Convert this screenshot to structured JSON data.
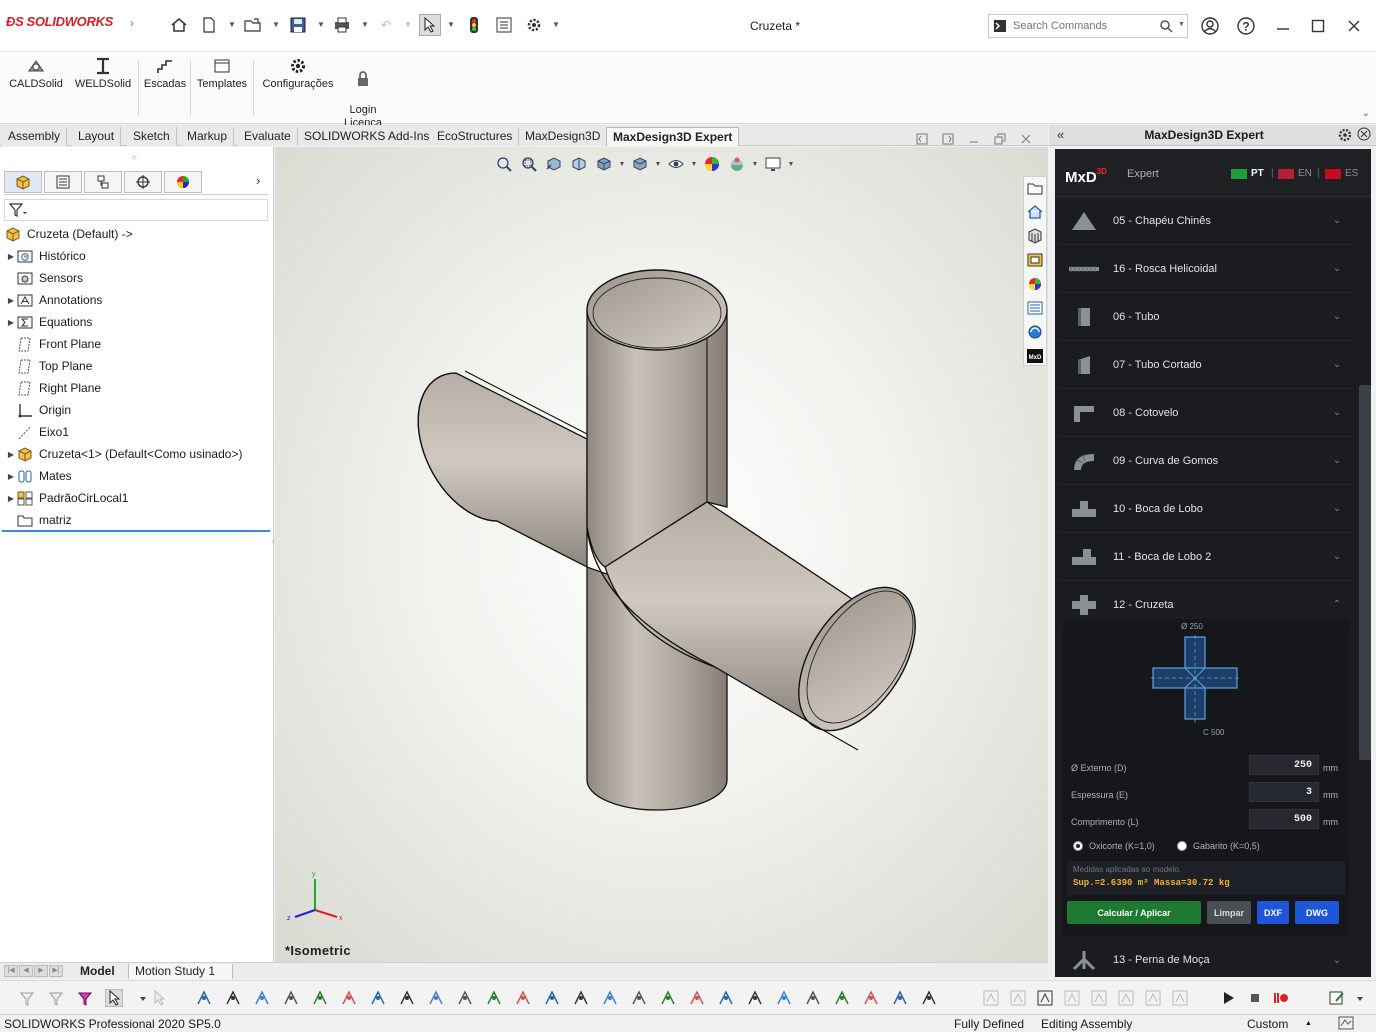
{
  "app": {
    "logo": "SOLIDWORKS",
    "document_title": "Cruzeta *",
    "search_placeholder": "Search Commands"
  },
  "ribbon": {
    "buttons": [
      {
        "label": "CALDSolid",
        "icon": "caldsolid-icon"
      },
      {
        "label": "WELDSolid",
        "icon": "weldsolid-icon"
      },
      {
        "label": "Escadas",
        "icon": "stairs-icon"
      },
      {
        "label": "Templates",
        "icon": "templates-icon"
      },
      {
        "label": "Configurações",
        "icon": "gear-icon"
      },
      {
        "label": "Login\nLicença",
        "icon": "lock-icon"
      }
    ]
  },
  "tabs": [
    {
      "label": "Assembly",
      "active": false
    },
    {
      "label": "Layout",
      "active": false
    },
    {
      "label": "Sketch",
      "active": false
    },
    {
      "label": "Markup",
      "active": false
    },
    {
      "label": "Evaluate",
      "active": false
    },
    {
      "label": "SOLIDWORKS Add-Ins",
      "active": false
    },
    {
      "label": "EcoStructures",
      "active": false
    },
    {
      "label": "MaxDesign3D",
      "active": false
    },
    {
      "label": "MaxDesign3D Expert",
      "active": true
    }
  ],
  "tree": {
    "root": "Cruzeta  (Default) ->",
    "items": [
      {
        "label": "Histórico",
        "icon": "history-folder-icon",
        "expandable": true
      },
      {
        "label": "Sensors",
        "icon": "sensors-folder-icon",
        "expandable": false
      },
      {
        "label": "Annotations",
        "icon": "annotations-icon",
        "expandable": true
      },
      {
        "label": "Equations",
        "icon": "equations-icon",
        "expandable": true
      },
      {
        "label": "Front Plane",
        "icon": "plane-icon",
        "expandable": false
      },
      {
        "label": "Top Plane",
        "icon": "plane-icon",
        "expandable": false
      },
      {
        "label": "Right Plane",
        "icon": "plane-icon",
        "expandable": false
      },
      {
        "label": "Origin",
        "icon": "origin-icon",
        "expandable": false
      },
      {
        "label": "Eixo1",
        "icon": "axis-icon",
        "expandable": false
      },
      {
        "label": "Cruzeta<1> (Default<Como usinado>)",
        "icon": "part-icon",
        "expandable": true
      },
      {
        "label": "Mates",
        "icon": "mates-icon",
        "expandable": true
      },
      {
        "label": "PadrãoCirLocal1",
        "icon": "circular-pattern-icon",
        "expandable": true
      },
      {
        "label": "matriz",
        "icon": "folder-icon",
        "expandable": false
      }
    ]
  },
  "viewport": {
    "view_label": "*Isometric",
    "triad": {
      "x": "x",
      "y": "y",
      "z": "z"
    }
  },
  "task_pane": {
    "title": "MaxDesign3D Expert",
    "panel": {
      "logo": "MxD",
      "logo_sup": "3D",
      "subtitle": "Expert",
      "languages": [
        {
          "code": "PT",
          "active": true,
          "flag_color": "#1f9d3a"
        },
        {
          "code": "EN",
          "active": false,
          "flag_color": "#b22234"
        },
        {
          "code": "ES",
          "active": false,
          "flag_color": "#c60b1e"
        }
      ],
      "categories": [
        {
          "label": "05 - Chapéu Chinês",
          "icon": "cone-icon",
          "expanded": false
        },
        {
          "label": "16 - Rosca Helicoidal",
          "icon": "helical-thread-icon",
          "expanded": false
        },
        {
          "label": "06 - Tubo",
          "icon": "tube-icon",
          "expanded": false
        },
        {
          "label": "07 - Tubo Cortado",
          "icon": "cut-tube-icon",
          "expanded": false
        },
        {
          "label": "08 - Cotovelo",
          "icon": "elbow-icon",
          "expanded": false
        },
        {
          "label": "09 - Curva de Gomos",
          "icon": "segmented-bend-icon",
          "expanded": false
        },
        {
          "label": "10 - Boca de Lobo",
          "icon": "saddle-icon",
          "expanded": false
        },
        {
          "label": "11 - Boca de Lobo 2",
          "icon": "saddle-2-icon",
          "expanded": false
        },
        {
          "label": "12 - Cruzeta",
          "icon": "cross-icon",
          "expanded": true
        }
      ],
      "detail": {
        "dim_diameter": "Ø 250",
        "dim_length": "C 500",
        "fields": [
          {
            "label": "Ø Externo (D)",
            "value": "250",
            "unit": "mm"
          },
          {
            "label": "Espessura (E)",
            "value": "3",
            "unit": "mm"
          },
          {
            "label": "Comprimento (L)",
            "value": "500",
            "unit": "mm"
          }
        ],
        "radios": [
          {
            "label": "Oxicorte (K=1,0)",
            "checked": true
          },
          {
            "label": "Gabarito (K=0,5)",
            "checked": false
          }
        ],
        "result_note": "Medidas aplicadas ao modelo.",
        "result_values": "Sup.=2.6390 m²   Massa=30.72 kg",
        "buttons": {
          "apply": "Calcular / Aplicar",
          "clear": "Limpar",
          "dxf": "DXF",
          "dwg": "DWG"
        },
        "colors": {
          "apply": "#1e7a32",
          "clear": "#4a4e55",
          "export": "#1f56d8"
        }
      },
      "next_category": {
        "label": "13 - Perna de Moça",
        "icon": "tripod-icon"
      }
    }
  },
  "model_tabs": [
    {
      "label": "Model",
      "active": true
    },
    {
      "label": "Motion Study 1",
      "active": false
    }
  ],
  "status": {
    "product": "SOLIDWORKS Professional 2020 SP5.0",
    "state": "Fully Defined",
    "mode": "Editing Assembly",
    "units": "Custom"
  }
}
